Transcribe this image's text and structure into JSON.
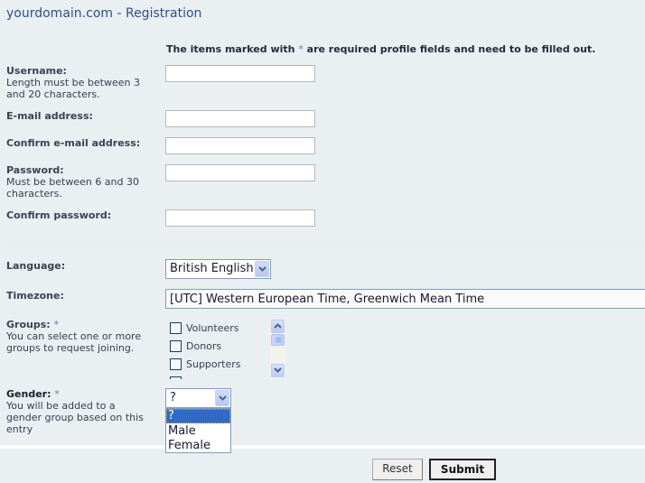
{
  "header": {
    "title": "yourdomain.com - Registration"
  },
  "notice": {
    "before": "The items marked with",
    "star": "*",
    "after": "are required profile fields and need to be filled out."
  },
  "fields": {
    "username": {
      "label": "Username:",
      "hint": "Length must be between 3 and 20 characters.",
      "value": ""
    },
    "email": {
      "label": "E-mail address:",
      "value": ""
    },
    "confirm_email": {
      "label": "Confirm e-mail address:",
      "value": ""
    },
    "password": {
      "label": "Password:",
      "hint": "Must be between 6 and 30 characters.",
      "value": ""
    },
    "confirm_password": {
      "label": "Confirm password:",
      "value": ""
    },
    "language": {
      "label": "Language:",
      "selected": "British English"
    },
    "timezone": {
      "label": "Timezone:",
      "selected": "[UTC] Western European Time, Greenwich Mean Time"
    },
    "groups": {
      "label": "Groups:",
      "required_mark": "*",
      "hint": "You can select one or more groups to request joining.",
      "options": [
        {
          "label": "Volunteers",
          "checked": false
        },
        {
          "label": "Donors",
          "checked": false
        },
        {
          "label": "Supporters",
          "checked": false
        }
      ]
    },
    "gender": {
      "label": "Gender:",
      "required_mark": "*",
      "hint": "You will be added to a gender group based on this entry",
      "selected": "?",
      "options": [
        "?",
        "Male",
        "Female"
      ],
      "highlighted": "?"
    }
  },
  "buttons": {
    "reset": "Reset",
    "submit": "Submit"
  },
  "colors": {
    "accent": "#2d5087",
    "background": "#eaeff2",
    "selection": "#316ac5"
  }
}
